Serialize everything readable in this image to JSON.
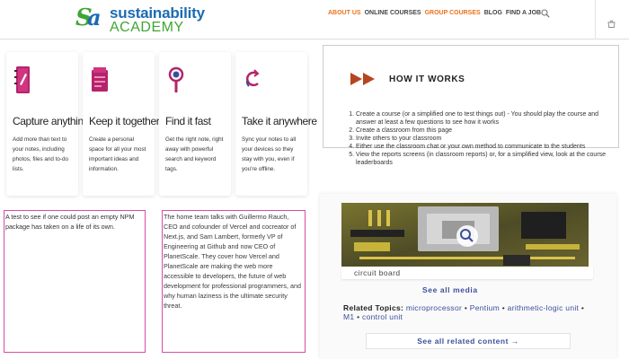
{
  "logo": {
    "line1": "sustainability",
    "line2": "ACADEMY",
    "colors": {
      "green": "#3fa535",
      "blue": "#1b6bb3"
    }
  },
  "nav": {
    "items": [
      {
        "label": "ABOUT US",
        "active": true
      },
      {
        "label": "ONLINE COURSES",
        "active": false
      },
      {
        "label": "GROUP COURSES",
        "active": true
      },
      {
        "label": "BLOG",
        "active": false
      },
      {
        "label": "FIND A JOB",
        "active": false
      }
    ],
    "accent_color": "#e8731b",
    "search_icon": "search-icon",
    "cart_icon": "cart-icon"
  },
  "features": [
    {
      "title": "Capture anything",
      "desc": "Add more than text to your notes, including photos, files and to-do lists.",
      "icon": "notebook-icon"
    },
    {
      "title": "Keep it together",
      "desc": "Create a personal space for all your most important ideas and information.",
      "icon": "folder-icon"
    },
    {
      "title": "Find it fast",
      "desc": "Get the right note, right away with powerful search and keyword tags.",
      "icon": "magnifier-icon"
    },
    {
      "title": "Take it anywhere",
      "desc": "Sync your notes to all your devices so they stay with you, even if you're offline.",
      "icon": "sync-icon"
    }
  ],
  "how_it_works": {
    "title": "HOW IT WORKS",
    "steps": [
      "Create a course (or a simplified one to test things out) - You should play the course and answer at least a few questions to see how it works",
      "Create a classroom from this page",
      "Invite others to your classroom",
      "Either use the classroom chat or your own method to communicate to the students",
      "View the reports screens (in classroom reports) or, for a simplified view, look at the course leaderboards"
    ]
  },
  "text_boxes": [
    "A test to see if one could post an empty NPM package has taken on a life of its own.",
    "The home team talks with Guillermo Rauch, CEO and cofounder of Vercel and cocreator of Next.js, and Sam Lambert, formerly VP of Engineering at Github and now CEO of PlanetScale. They cover how Vercel and PlanetScale are making the web more accessible to developers, the future of web development for professional programmers, and why human laziness is the ultimate security threat."
  ],
  "media": {
    "caption": "circuit board",
    "see_all_media": "See all media",
    "related_label": "Related Topics:",
    "related_topics": [
      "microprocessor",
      "Pentium",
      "arithmetic-logic unit",
      "M1",
      "control unit"
    ],
    "see_all_related": "See all related content →"
  }
}
